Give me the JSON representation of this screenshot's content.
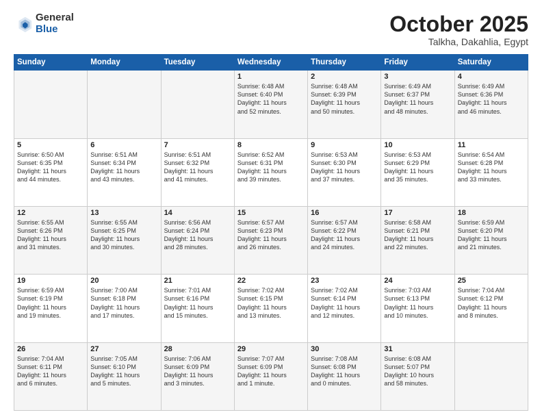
{
  "logo": {
    "general": "General",
    "blue": "Blue"
  },
  "header": {
    "title": "October 2025",
    "subtitle": "Talkha, Dakahlia, Egypt"
  },
  "weekdays": [
    "Sunday",
    "Monday",
    "Tuesday",
    "Wednesday",
    "Thursday",
    "Friday",
    "Saturday"
  ],
  "weeks": [
    [
      {
        "day": "",
        "info": ""
      },
      {
        "day": "",
        "info": ""
      },
      {
        "day": "",
        "info": ""
      },
      {
        "day": "1",
        "info": "Sunrise: 6:48 AM\nSunset: 6:40 PM\nDaylight: 11 hours\nand 52 minutes."
      },
      {
        "day": "2",
        "info": "Sunrise: 6:48 AM\nSunset: 6:39 PM\nDaylight: 11 hours\nand 50 minutes."
      },
      {
        "day": "3",
        "info": "Sunrise: 6:49 AM\nSunset: 6:37 PM\nDaylight: 11 hours\nand 48 minutes."
      },
      {
        "day": "4",
        "info": "Sunrise: 6:49 AM\nSunset: 6:36 PM\nDaylight: 11 hours\nand 46 minutes."
      }
    ],
    [
      {
        "day": "5",
        "info": "Sunrise: 6:50 AM\nSunset: 6:35 PM\nDaylight: 11 hours\nand 44 minutes."
      },
      {
        "day": "6",
        "info": "Sunrise: 6:51 AM\nSunset: 6:34 PM\nDaylight: 11 hours\nand 43 minutes."
      },
      {
        "day": "7",
        "info": "Sunrise: 6:51 AM\nSunset: 6:32 PM\nDaylight: 11 hours\nand 41 minutes."
      },
      {
        "day": "8",
        "info": "Sunrise: 6:52 AM\nSunset: 6:31 PM\nDaylight: 11 hours\nand 39 minutes."
      },
      {
        "day": "9",
        "info": "Sunrise: 6:53 AM\nSunset: 6:30 PM\nDaylight: 11 hours\nand 37 minutes."
      },
      {
        "day": "10",
        "info": "Sunrise: 6:53 AM\nSunset: 6:29 PM\nDaylight: 11 hours\nand 35 minutes."
      },
      {
        "day": "11",
        "info": "Sunrise: 6:54 AM\nSunset: 6:28 PM\nDaylight: 11 hours\nand 33 minutes."
      }
    ],
    [
      {
        "day": "12",
        "info": "Sunrise: 6:55 AM\nSunset: 6:26 PM\nDaylight: 11 hours\nand 31 minutes."
      },
      {
        "day": "13",
        "info": "Sunrise: 6:55 AM\nSunset: 6:25 PM\nDaylight: 11 hours\nand 30 minutes."
      },
      {
        "day": "14",
        "info": "Sunrise: 6:56 AM\nSunset: 6:24 PM\nDaylight: 11 hours\nand 28 minutes."
      },
      {
        "day": "15",
        "info": "Sunrise: 6:57 AM\nSunset: 6:23 PM\nDaylight: 11 hours\nand 26 minutes."
      },
      {
        "day": "16",
        "info": "Sunrise: 6:57 AM\nSunset: 6:22 PM\nDaylight: 11 hours\nand 24 minutes."
      },
      {
        "day": "17",
        "info": "Sunrise: 6:58 AM\nSunset: 6:21 PM\nDaylight: 11 hours\nand 22 minutes."
      },
      {
        "day": "18",
        "info": "Sunrise: 6:59 AM\nSunset: 6:20 PM\nDaylight: 11 hours\nand 21 minutes."
      }
    ],
    [
      {
        "day": "19",
        "info": "Sunrise: 6:59 AM\nSunset: 6:19 PM\nDaylight: 11 hours\nand 19 minutes."
      },
      {
        "day": "20",
        "info": "Sunrise: 7:00 AM\nSunset: 6:18 PM\nDaylight: 11 hours\nand 17 minutes."
      },
      {
        "day": "21",
        "info": "Sunrise: 7:01 AM\nSunset: 6:16 PM\nDaylight: 11 hours\nand 15 minutes."
      },
      {
        "day": "22",
        "info": "Sunrise: 7:02 AM\nSunset: 6:15 PM\nDaylight: 11 hours\nand 13 minutes."
      },
      {
        "day": "23",
        "info": "Sunrise: 7:02 AM\nSunset: 6:14 PM\nDaylight: 11 hours\nand 12 minutes."
      },
      {
        "day": "24",
        "info": "Sunrise: 7:03 AM\nSunset: 6:13 PM\nDaylight: 11 hours\nand 10 minutes."
      },
      {
        "day": "25",
        "info": "Sunrise: 7:04 AM\nSunset: 6:12 PM\nDaylight: 11 hours\nand 8 minutes."
      }
    ],
    [
      {
        "day": "26",
        "info": "Sunrise: 7:04 AM\nSunset: 6:11 PM\nDaylight: 11 hours\nand 6 minutes."
      },
      {
        "day": "27",
        "info": "Sunrise: 7:05 AM\nSunset: 6:10 PM\nDaylight: 11 hours\nand 5 minutes."
      },
      {
        "day": "28",
        "info": "Sunrise: 7:06 AM\nSunset: 6:09 PM\nDaylight: 11 hours\nand 3 minutes."
      },
      {
        "day": "29",
        "info": "Sunrise: 7:07 AM\nSunset: 6:09 PM\nDaylight: 11 hours\nand 1 minute."
      },
      {
        "day": "30",
        "info": "Sunrise: 7:08 AM\nSunset: 6:08 PM\nDaylight: 11 hours\nand 0 minutes."
      },
      {
        "day": "31",
        "info": "Sunrise: 6:08 AM\nSunset: 5:07 PM\nDaylight: 10 hours\nand 58 minutes."
      },
      {
        "day": "",
        "info": ""
      }
    ]
  ]
}
